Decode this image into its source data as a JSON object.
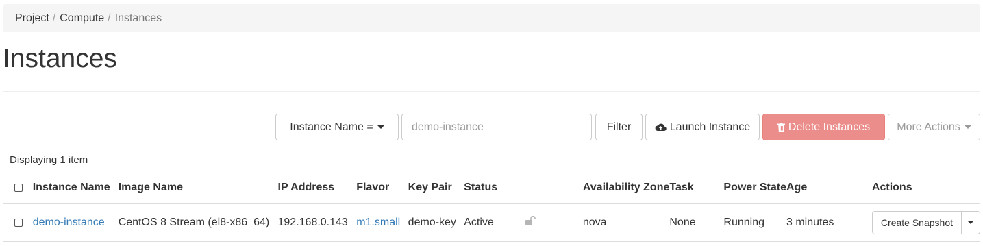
{
  "breadcrumb": {
    "items": [
      "Project",
      "Compute",
      "Instances"
    ],
    "separator": "/"
  },
  "page": {
    "title": "Instances"
  },
  "toolbar": {
    "filter_field_label": "Instance Name =",
    "search_placeholder": "demo-instance",
    "filter_button": "Filter",
    "launch_button": "Launch Instance",
    "delete_button": "Delete Instances",
    "more_actions": "More Actions"
  },
  "table": {
    "count_text": "Displaying 1 item",
    "headers": [
      "Instance Name",
      "Image Name",
      "IP Address",
      "Flavor",
      "Key Pair",
      "Status",
      "Availability Zone",
      "Task",
      "Power State",
      "Age",
      "Actions"
    ],
    "rows": [
      {
        "instance_name": "demo-instance",
        "image_name": "CentOS 8 Stream (el8-x86_64)",
        "ip_address": "192.168.0.143",
        "flavor": "m1.small",
        "key_pair": "demo-key",
        "status": "Active",
        "availability_zone": "nova",
        "task": "None",
        "power_state": "Running",
        "age": "3 minutes",
        "action": "Create Snapshot"
      }
    ]
  },
  "icons": {
    "launch": "cloud-upload-icon",
    "delete": "trash-icon",
    "lock": "unlocked-padlock-icon"
  },
  "colors": {
    "link": "#337ab7",
    "danger": "#eb8d8a",
    "breadcrumb_bg": "#f5f5f5"
  }
}
